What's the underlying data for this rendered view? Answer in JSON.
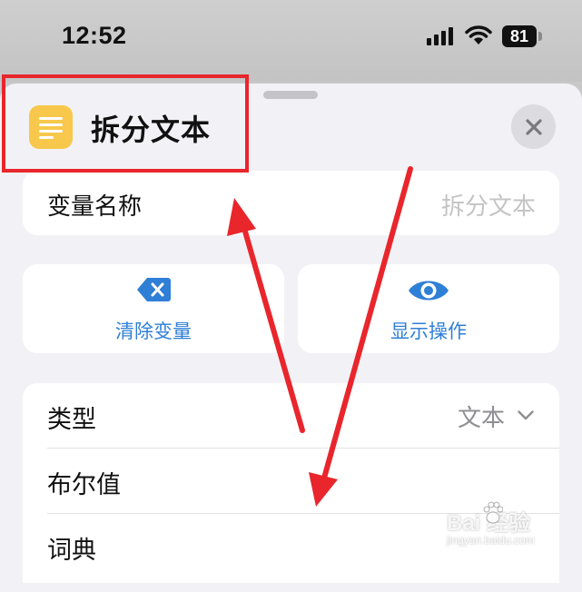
{
  "status_bar": {
    "time": "12:52",
    "battery": "81"
  },
  "header": {
    "title": "拆分文本",
    "app_icon": "text-lines-icon",
    "close_icon": "close-icon"
  },
  "variable": {
    "label": "变量名称",
    "value": "拆分文本"
  },
  "actions": {
    "clear": {
      "label": "清除变量",
      "icon": "clear-delete-icon"
    },
    "show": {
      "label": "显示操作",
      "icon": "eye-icon"
    }
  },
  "types": {
    "rows": [
      {
        "label": "类型",
        "value": "文本"
      },
      {
        "label": "布尔值"
      },
      {
        "label": "词典"
      }
    ]
  },
  "watermark": {
    "brand": "Bai  经验",
    "sub": "jingyan.baidu.com"
  },
  "colors": {
    "accent": "#2f7fd6",
    "annotation": "#e8262c",
    "app_icon": "#f7c84b"
  }
}
